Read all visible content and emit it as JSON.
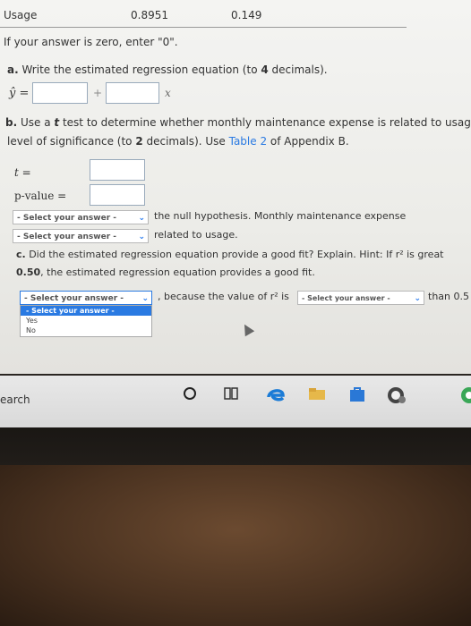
{
  "table": {
    "col1": "Usage",
    "col2": "0.8951",
    "col3": "0.149"
  },
  "instructions": {
    "zero_note": "If your answer is zero, enter \"0\"."
  },
  "part_a": {
    "label": "a.",
    "text": "Write the estimated regression equation (to ",
    "decimals": "4",
    "text_end": " decimals).",
    "yhat": "ŷ =",
    "plus": "+",
    "x": "x"
  },
  "part_b": {
    "label": "b.",
    "line1_a": "Use a ",
    "line1_t": "t",
    "line1_b": " test to determine whether monthly maintenance expense is related to usag",
    "line2_a": "level of significance (to ",
    "line2_dec": "2",
    "line2_b": " decimals). Use ",
    "link": "Table 2",
    "line2_c": " of Appendix B.",
    "t_label": "t =",
    "p_label": "p-value =",
    "select1": "- Select your answer -",
    "after_select1": "the null hypothesis. Monthly maintenance expense",
    "select2": "- Select your answer -",
    "after_select2": "related to usage."
  },
  "part_c": {
    "label": "c.",
    "line1": "Did the estimated regression equation provide a good fit? Explain. Hint: If r² is great",
    "line2_val": "0.50",
    "line2": ", the estimated regression equation provides a good fit.",
    "select3": "- Select your answer -",
    "because": ", because the value of r² is",
    "select4": "- Select your answer -",
    "than": "than 0.5",
    "dropdown_options": [
      "- Select your answer -",
      "Yes",
      "No"
    ]
  },
  "taskbar": {
    "search": "earch"
  },
  "colors": {
    "link": "#2a7ae2",
    "highlight": "#2a7ae2"
  },
  "icons": [
    "cortana-icon",
    "task-view-icon",
    "edge-icon",
    "file-explorer-icon",
    "store-icon",
    "xbox-icon",
    "chrome-icon"
  ]
}
